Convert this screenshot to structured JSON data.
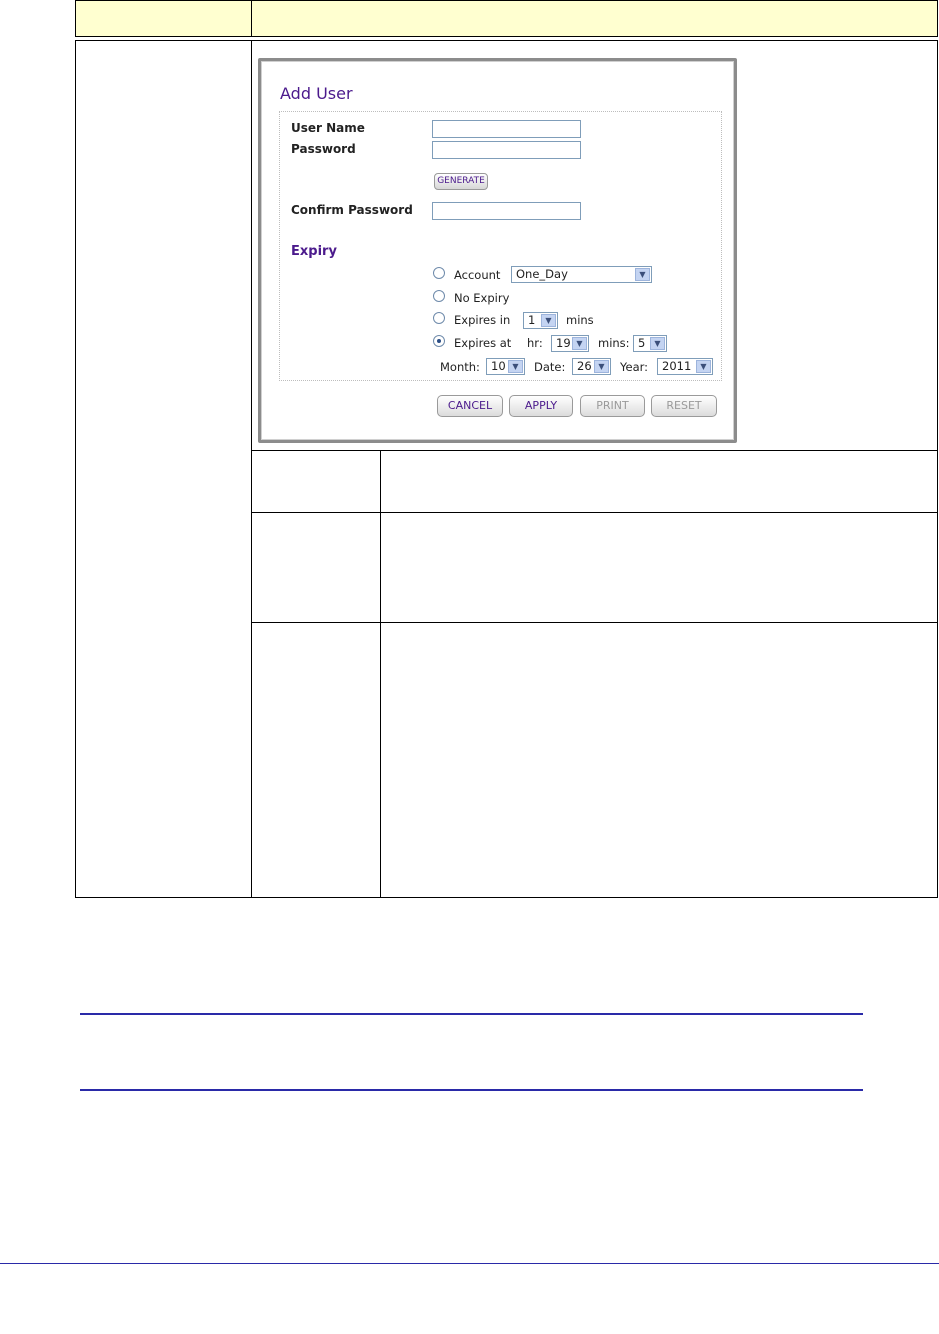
{
  "dialog": {
    "title": "Add User",
    "fields": {
      "user_name_label": "User Name",
      "user_name_value": "",
      "password_label": "Password",
      "password_value": "",
      "generate_label": "GENERATE",
      "confirm_label": "Confirm Password",
      "confirm_value": ""
    },
    "expiry": {
      "section_label": "Expiry",
      "account_label": "Account",
      "account_value": "One_Day",
      "no_expiry_label": "No Expiry",
      "expires_in_label": "Expires in",
      "expires_in_value": "1",
      "mins_label": "mins",
      "expires_at_label": "Expires at",
      "hr_label": "hr:",
      "hr_value": "19",
      "mins_at_label": "mins:",
      "mins_at_value": "5",
      "month_label": "Month:",
      "month_value": "10",
      "date_label": "Date:",
      "date_value": "26",
      "year_label": "Year:",
      "year_value": "2011",
      "selected_option": "expires_at"
    },
    "buttons": {
      "cancel": "CANCEL",
      "apply": "APPLY",
      "print": "PRINT",
      "reset": "RESET"
    }
  },
  "colors": {
    "header_fill": "#ffffd0",
    "accent_purple": "#4b1a8c",
    "rule_blue": "#2a2aa8"
  }
}
